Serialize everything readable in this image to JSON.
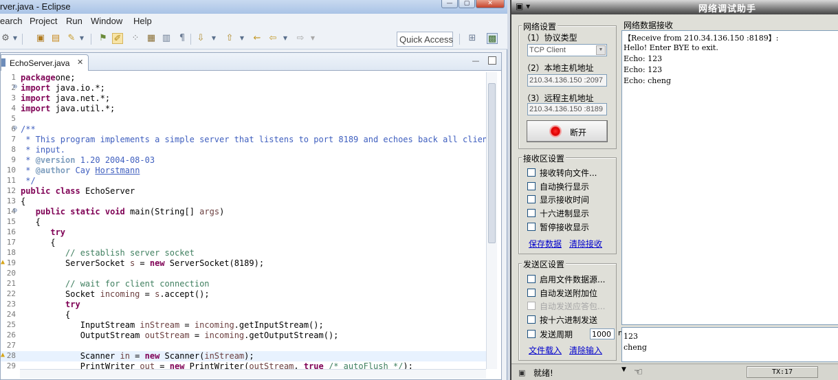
{
  "eclipse": {
    "title": "rver.java - Eclipse",
    "window_controls": {
      "minimize": "—",
      "maximize": "▢",
      "close": "✕"
    },
    "menu": [
      "earch",
      "Project",
      "Run",
      "Window",
      "Help"
    ],
    "quick_access_placeholder": "Quick Access",
    "editor_tab": {
      "label": "EchoServer.java",
      "close": "✕"
    },
    "editor_controls": {
      "minimize": "—"
    },
    "current_line": 28,
    "code_lines": [
      {
        "n": "1",
        "fold": "",
        "warn": false,
        "segs": [
          [
            "kw",
            "package"
          ],
          [
            "",
            "one;"
          ]
        ]
      },
      {
        "n": "2",
        "fold": "⊖",
        "warn": false,
        "segs": [
          [
            "kw",
            "import"
          ],
          [
            "",
            " java.io.*;"
          ]
        ]
      },
      {
        "n": "3",
        "fold": "",
        "warn": false,
        "segs": [
          [
            "kw",
            "import"
          ],
          [
            "",
            " java.net.*;"
          ]
        ]
      },
      {
        "n": "4",
        "fold": "",
        "warn": false,
        "segs": [
          [
            "kw",
            "import"
          ],
          [
            "",
            " java.util.*;"
          ]
        ]
      },
      {
        "n": "5",
        "fold": "",
        "warn": false,
        "segs": []
      },
      {
        "n": "6",
        "fold": "⊖",
        "warn": false,
        "segs": [
          [
            "jd",
            "/**"
          ]
        ]
      },
      {
        "n": "7",
        "fold": "",
        "warn": false,
        "segs": [
          [
            "jd",
            " * This program implements a simple server that listens to port 8189 and echoes back all client"
          ]
        ]
      },
      {
        "n": "8",
        "fold": "",
        "warn": false,
        "segs": [
          [
            "jd",
            " * input."
          ]
        ]
      },
      {
        "n": "9",
        "fold": "",
        "warn": false,
        "segs": [
          [
            "jd",
            " * "
          ],
          [
            "jt",
            "@version"
          ],
          [
            "jd",
            " 1.20 2004-08-03"
          ]
        ]
      },
      {
        "n": "10",
        "fold": "",
        "warn": false,
        "segs": [
          [
            "jd",
            " * "
          ],
          [
            "jt",
            "@author"
          ],
          [
            "jd",
            " Cay "
          ],
          [
            "jd ul",
            "Horstmann"
          ]
        ]
      },
      {
        "n": "11",
        "fold": "",
        "warn": false,
        "segs": [
          [
            "jd",
            " */"
          ]
        ]
      },
      {
        "n": "12",
        "fold": "",
        "warn": false,
        "segs": [
          [
            "kw",
            "public"
          ],
          [
            "",
            " "
          ],
          [
            "kw",
            "class"
          ],
          [
            "",
            " EchoServer"
          ]
        ]
      },
      {
        "n": "13",
        "fold": "",
        "warn": false,
        "segs": [
          [
            "",
            "{"
          ]
        ]
      },
      {
        "n": "14",
        "fold": "⊖",
        "warn": false,
        "segs": [
          [
            "",
            "   "
          ],
          [
            "kw",
            "public"
          ],
          [
            "",
            " "
          ],
          [
            "kw",
            "static"
          ],
          [
            "",
            " "
          ],
          [
            "kw",
            "void"
          ],
          [
            "",
            " main(String[] "
          ],
          [
            "var",
            "args"
          ],
          [
            "",
            ")"
          ]
        ]
      },
      {
        "n": "15",
        "fold": "",
        "warn": false,
        "segs": [
          [
            "",
            "   {"
          ]
        ]
      },
      {
        "n": "16",
        "fold": "",
        "warn": false,
        "segs": [
          [
            "",
            "      "
          ],
          [
            "kw",
            "try"
          ]
        ]
      },
      {
        "n": "17",
        "fold": "",
        "warn": false,
        "segs": [
          [
            "",
            "      {"
          ]
        ]
      },
      {
        "n": "18",
        "fold": "",
        "warn": false,
        "segs": [
          [
            "cm",
            "         // establish server socket"
          ]
        ]
      },
      {
        "n": "19",
        "fold": "",
        "warn": true,
        "segs": [
          [
            "",
            "         ServerSocket "
          ],
          [
            "var",
            "s"
          ],
          [
            "",
            " = "
          ],
          [
            "kw",
            "new"
          ],
          [
            "",
            " ServerSocket(8189);"
          ]
        ]
      },
      {
        "n": "20",
        "fold": "",
        "warn": false,
        "segs": []
      },
      {
        "n": "21",
        "fold": "",
        "warn": false,
        "segs": [
          [
            "cm",
            "         // wait for client connection"
          ]
        ]
      },
      {
        "n": "22",
        "fold": "",
        "warn": false,
        "segs": [
          [
            "",
            "         Socket "
          ],
          [
            "var",
            "incoming"
          ],
          [
            "",
            " = "
          ],
          [
            "var",
            "s"
          ],
          [
            "",
            ".accept();"
          ]
        ]
      },
      {
        "n": "23",
        "fold": "",
        "warn": false,
        "segs": [
          [
            "",
            "         "
          ],
          [
            "kw",
            "try"
          ]
        ]
      },
      {
        "n": "24",
        "fold": "",
        "warn": false,
        "segs": [
          [
            "",
            "         {"
          ]
        ]
      },
      {
        "n": "25",
        "fold": "",
        "warn": false,
        "segs": [
          [
            "",
            "            InputStream "
          ],
          [
            "var",
            "inStream"
          ],
          [
            "",
            " = "
          ],
          [
            "var",
            "incoming"
          ],
          [
            "",
            ".getInputStream();"
          ]
        ]
      },
      {
        "n": "26",
        "fold": "",
        "warn": false,
        "segs": [
          [
            "",
            "            OutputStream "
          ],
          [
            "var",
            "outStream"
          ],
          [
            "",
            " = "
          ],
          [
            "var",
            "incoming"
          ],
          [
            "",
            ".getOutputStream();"
          ]
        ]
      },
      {
        "n": "27",
        "fold": "",
        "warn": false,
        "segs": []
      },
      {
        "n": "28",
        "fold": "",
        "warn": true,
        "segs": [
          [
            "",
            "            Scanner "
          ],
          [
            "var",
            "in"
          ],
          [
            "",
            " = "
          ],
          [
            "kw",
            "new"
          ],
          [
            "",
            " Scanner("
          ],
          [
            "var",
            "inStream"
          ],
          [
            "",
            ");"
          ]
        ]
      },
      {
        "n": "29",
        "fold": "",
        "warn": false,
        "segs": [
          [
            "",
            "            PrintWriter "
          ],
          [
            "var",
            "out"
          ],
          [
            "",
            " = "
          ],
          [
            "kw",
            "new"
          ],
          [
            "",
            " PrintWriter("
          ],
          [
            "var",
            "outStream"
          ],
          [
            "",
            ", "
          ],
          [
            "kw",
            "true"
          ],
          [
            "",
            " "
          ],
          [
            "cm",
            "/* autoFlush */"
          ],
          [
            "",
            ");"
          ]
        ]
      }
    ]
  },
  "netapp": {
    "title": "网络调试助手",
    "sys_menu": "▣ ▾",
    "network_settings": {
      "title": "网络设置",
      "protocol_label": "（1）协议类型",
      "protocol_value": "TCP Client",
      "local_label": "（2）本地主机地址",
      "local_value": "210.34.136.150 :2097",
      "remote_label": "（3）远程主机地址",
      "remote_value": "210.34.136.150 :8189",
      "disconnect_label": "断开"
    },
    "receive_settings": {
      "title": "接收区设置",
      "options": [
        {
          "label": "接收转向文件...",
          "disabled": false
        },
        {
          "label": "自动换行显示",
          "disabled": false
        },
        {
          "label": "显示接收时间",
          "disabled": false
        },
        {
          "label": "十六进制显示",
          "disabled": false
        },
        {
          "label": "暂停接收显示",
          "disabled": false
        }
      ],
      "save_link": "保存数据",
      "clear_link": "清除接收"
    },
    "send_settings": {
      "title": "发送区设置",
      "options": [
        {
          "label": "启用文件数据源...",
          "disabled": false
        },
        {
          "label": "自动发送附加位",
          "disabled": false
        },
        {
          "label": "自动发送应答包...",
          "disabled": true
        },
        {
          "label": "按十六进制发送",
          "disabled": false
        }
      ],
      "period_label": "发送周期",
      "period_value": "1000",
      "period_unit": "ms",
      "load_link": "文件载入",
      "clear_link": "清除输入"
    },
    "receive_panel": {
      "title": "网络数据接收",
      "lines": [
        "【Receive from 210.34.136.150 :8189】:",
        "Hello! Enter BYE to exit.",
        "Echo: 123",
        "Echo: 123",
        "Echo: cheng"
      ]
    },
    "send_panel": {
      "lines": [
        "123",
        "cheng"
      ]
    },
    "status": {
      "text": "就绪!",
      "tx": "TX:17"
    }
  }
}
